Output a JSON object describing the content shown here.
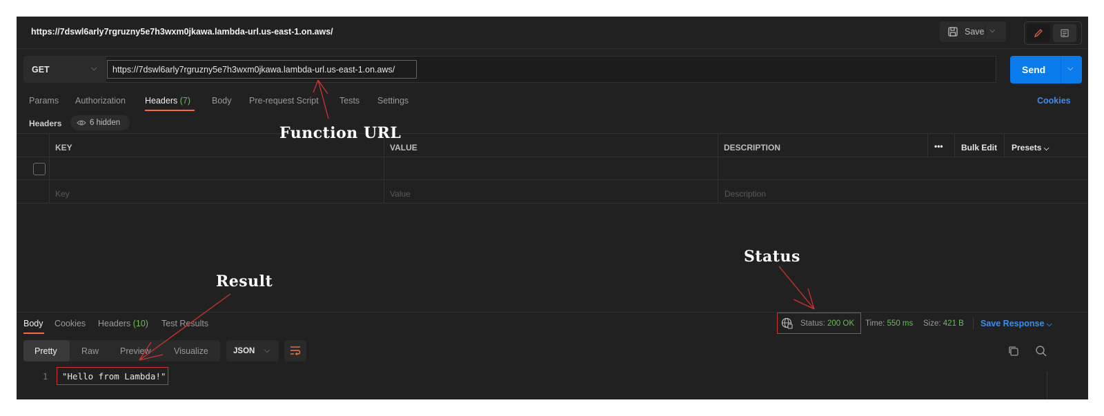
{
  "window": {
    "title_url": "https://7dswl6arly7rgruzny5e7h3wxm0jkawa.lambda-url.us-east-1.on.aws/",
    "save_label": "Save"
  },
  "request": {
    "method": "GET",
    "url": "https://7dswl6arly7rgruzny5e7h3wxm0jkawa.lambda-url.us-east-1.on.aws/",
    "send_label": "Send"
  },
  "request_tabs": {
    "params": "Params",
    "authorization": "Authorization",
    "headers": "Headers",
    "headers_count": "(7)",
    "body": "Body",
    "pre_request": "Pre-request Script",
    "tests": "Tests",
    "settings": "Settings",
    "cookies": "Cookies"
  },
  "headers_section": {
    "label": "Headers",
    "hidden": "6 hidden"
  },
  "headers_table": {
    "columns": {
      "key": "KEY",
      "value": "VALUE",
      "description": "DESCRIPTION"
    },
    "more": "•••",
    "bulk_edit": "Bulk Edit",
    "presets": "Presets",
    "placeholders": {
      "key": "Key",
      "value": "Value",
      "description": "Description"
    }
  },
  "response_tabs": {
    "body": "Body",
    "cookies": "Cookies",
    "headers": "Headers",
    "headers_count": "(10)",
    "test_results": "Test Results"
  },
  "response_meta": {
    "status_label": "Status:",
    "status_value": "200 OK",
    "time_label": "Time:",
    "time_value": "550 ms",
    "size_label": "Size:",
    "size_value": "421 B",
    "save_response": "Save Response"
  },
  "view_modes": {
    "pretty": "Pretty",
    "raw": "Raw",
    "preview": "Preview",
    "visualize": "Visualize",
    "format": "JSON"
  },
  "code": {
    "line_number": "1",
    "line": "\"Hello from Lambda!\""
  },
  "annotations": {
    "function_url": "Function URL",
    "status": "Status",
    "result": "Result"
  },
  "colors": {
    "accent": "#ff6c37",
    "send": "#097bed",
    "link": "#3b8ef0",
    "success": "#6bbf59",
    "annotation": "#d0342c"
  },
  "icons": [
    "save-icon",
    "chevron-down-icon",
    "pencil-icon",
    "document-icon",
    "eye-icon",
    "globe-icon",
    "copy-icon",
    "search-icon",
    "wrap-icon"
  ]
}
